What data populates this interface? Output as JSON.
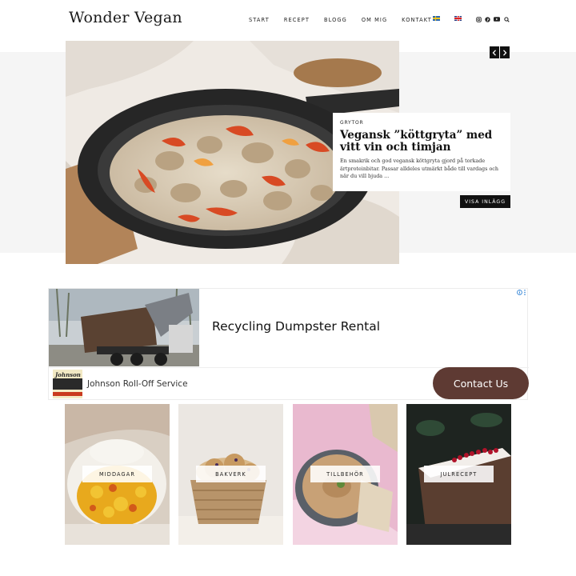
{
  "site": {
    "logo": "Wonder Vegan"
  },
  "nav": {
    "items": [
      "START",
      "RECEPT",
      "BLOGG",
      "OM MIG",
      "KONTAKT"
    ],
    "languages": [
      "swedish-flag",
      "english-flag"
    ],
    "social_icons": [
      "instagram-icon",
      "pinterest-icon",
      "youtube-icon",
      "search-icon"
    ]
  },
  "hero": {
    "category": "GRYTOR",
    "title": "Vegansk ”köttgryta” med vitt vin och timjan",
    "excerpt": "En smakrik och god vegansk köttgryta gjord på torkade ärtproteinbitar. Passar alldeles utmärkt både till vardags och när du vill bjuda ...",
    "button": "VISA INLÄGG",
    "prev_icon": "chevron-left-icon",
    "next_icon": "chevron-right-icon"
  },
  "ad": {
    "headline": "Recycling Dumpster Rental",
    "company": "Johnson Roll-Off Service",
    "logo_text": "Johnson",
    "cta": "Contact Us",
    "cta_color": "#5e3a33"
  },
  "categories": [
    {
      "label": "MIDDAGAR"
    },
    {
      "label": "BAKVERK"
    },
    {
      "label": "TILLBEHÖR"
    },
    {
      "label": "JULRECEPT"
    }
  ]
}
